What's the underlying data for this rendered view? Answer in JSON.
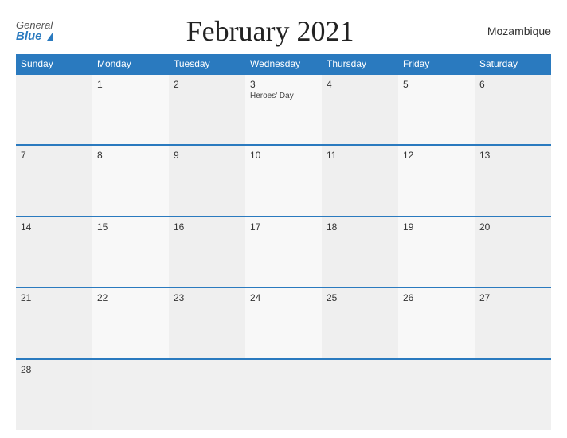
{
  "header": {
    "logo_general": "General",
    "logo_blue": "Blue",
    "title": "February 2021",
    "country": "Mozambique"
  },
  "calendar": {
    "days_of_week": [
      "Sunday",
      "Monday",
      "Tuesday",
      "Wednesday",
      "Thursday",
      "Friday",
      "Saturday"
    ],
    "weeks": [
      [
        {
          "day": "",
          "holiday": ""
        },
        {
          "day": "1",
          "holiday": ""
        },
        {
          "day": "2",
          "holiday": ""
        },
        {
          "day": "3",
          "holiday": "Heroes' Day"
        },
        {
          "day": "4",
          "holiday": ""
        },
        {
          "day": "5",
          "holiday": ""
        },
        {
          "day": "6",
          "holiday": ""
        }
      ],
      [
        {
          "day": "7",
          "holiday": ""
        },
        {
          "day": "8",
          "holiday": ""
        },
        {
          "day": "9",
          "holiday": ""
        },
        {
          "day": "10",
          "holiday": ""
        },
        {
          "day": "11",
          "holiday": ""
        },
        {
          "day": "12",
          "holiday": ""
        },
        {
          "day": "13",
          "holiday": ""
        }
      ],
      [
        {
          "day": "14",
          "holiday": ""
        },
        {
          "day": "15",
          "holiday": ""
        },
        {
          "day": "16",
          "holiday": ""
        },
        {
          "day": "17",
          "holiday": ""
        },
        {
          "day": "18",
          "holiday": ""
        },
        {
          "day": "19",
          "holiday": ""
        },
        {
          "day": "20",
          "holiday": ""
        }
      ],
      [
        {
          "day": "21",
          "holiday": ""
        },
        {
          "day": "22",
          "holiday": ""
        },
        {
          "day": "23",
          "holiday": ""
        },
        {
          "day": "24",
          "holiday": ""
        },
        {
          "day": "25",
          "holiday": ""
        },
        {
          "day": "26",
          "holiday": ""
        },
        {
          "day": "27",
          "holiday": ""
        }
      ],
      [
        {
          "day": "28",
          "holiday": ""
        },
        {
          "day": "",
          "holiday": ""
        },
        {
          "day": "",
          "holiday": ""
        },
        {
          "day": "",
          "holiday": ""
        },
        {
          "day": "",
          "holiday": ""
        },
        {
          "day": "",
          "holiday": ""
        },
        {
          "day": "",
          "holiday": ""
        }
      ]
    ]
  }
}
